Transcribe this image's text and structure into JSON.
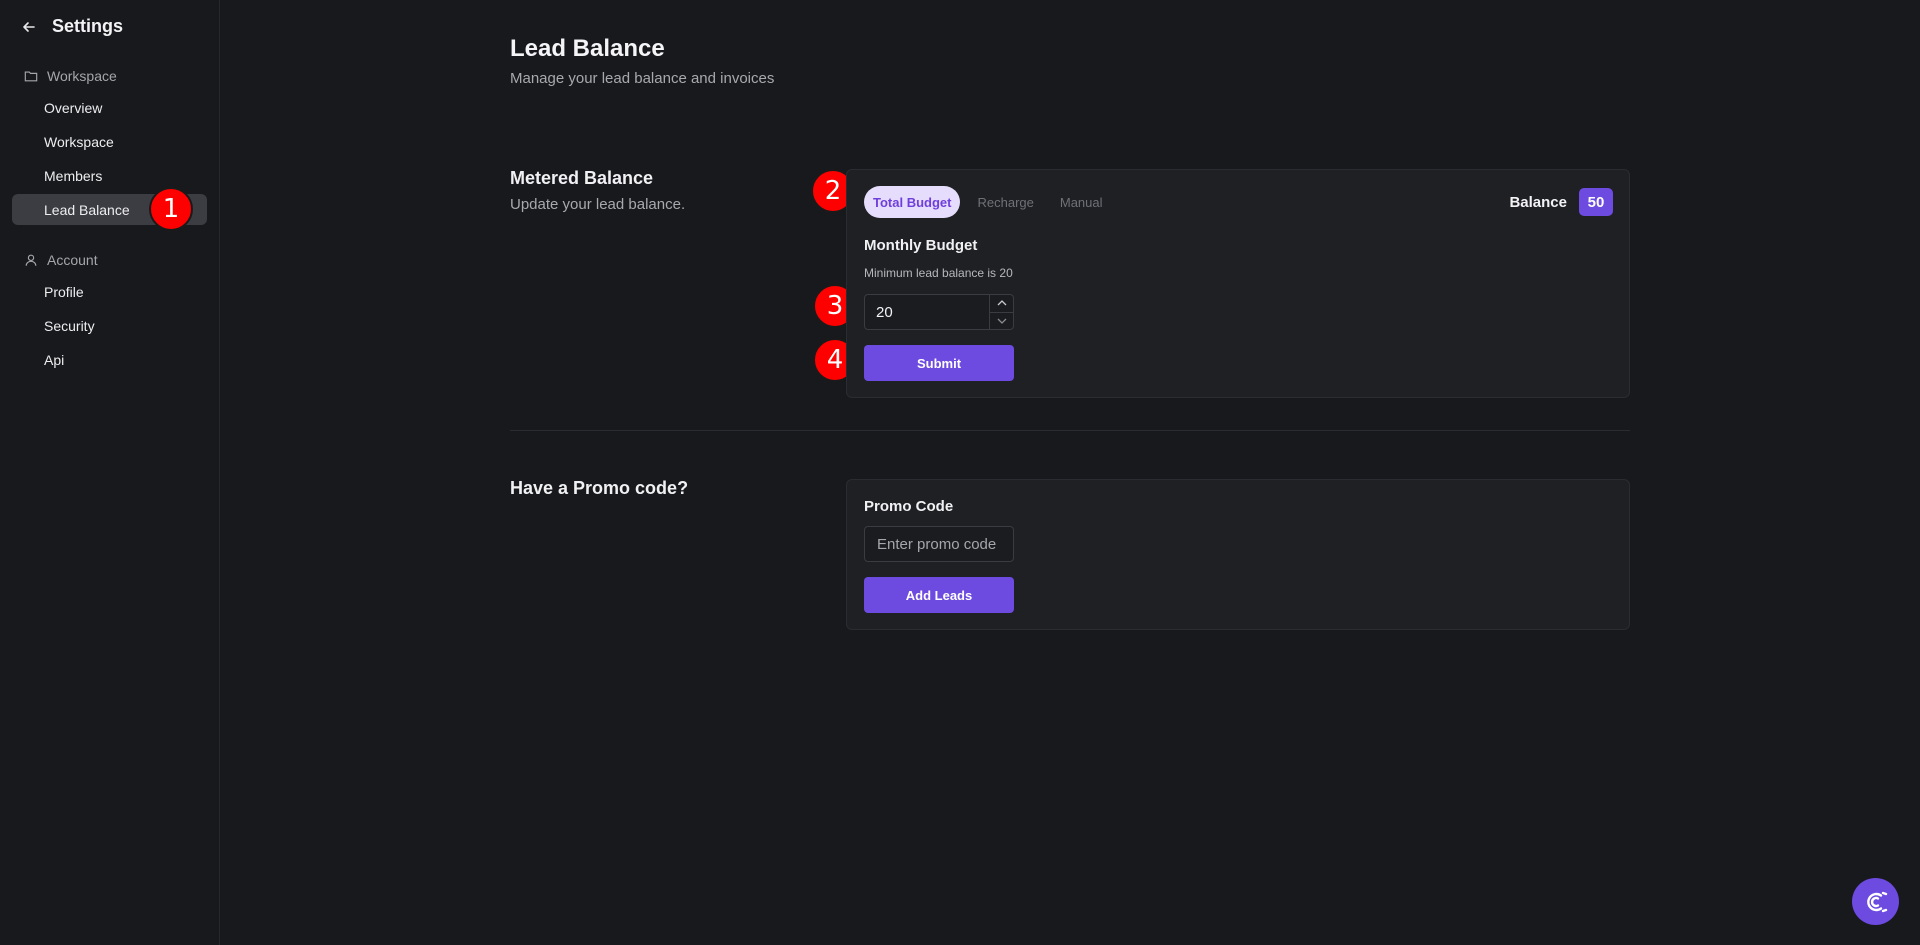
{
  "sidebar": {
    "title": "Settings",
    "groups": [
      {
        "label": "Workspace",
        "icon": "folder-icon"
      },
      {
        "label": "Account",
        "icon": "user-icon"
      }
    ],
    "items": [
      {
        "label": "Overview"
      },
      {
        "label": "Workspace"
      },
      {
        "label": "Members"
      },
      {
        "label": "Lead Balance",
        "active": true
      },
      {
        "label": "Profile"
      },
      {
        "label": "Security"
      },
      {
        "label": "Api"
      }
    ]
  },
  "annotations": [
    "1",
    "2",
    "3",
    "4"
  ],
  "header": {
    "title": "Lead Balance",
    "subtitle": "Manage your lead balance and invoices"
  },
  "metered": {
    "title": "Metered Balance",
    "subtitle": "Update your lead balance.",
    "tabs": [
      {
        "label": "Total Budget",
        "active": true
      },
      {
        "label": "Recharge"
      },
      {
        "label": "Manual"
      }
    ],
    "balance_label": "Balance",
    "balance_value": "50",
    "field_label": "Monthly Budget",
    "field_help": "Minimum lead balance is 20",
    "input_value": "20",
    "submit_label": "Submit"
  },
  "promo": {
    "title": "Have a Promo code?",
    "field_label": "Promo Code",
    "placeholder": "Enter promo code",
    "button_label": "Add Leads"
  },
  "colors": {
    "accent": "#6d4ae0",
    "tab_active_bg": "#e6dcfb",
    "annotation": "#ff0000"
  },
  "fab": {
    "icon": "magnet-icon"
  }
}
